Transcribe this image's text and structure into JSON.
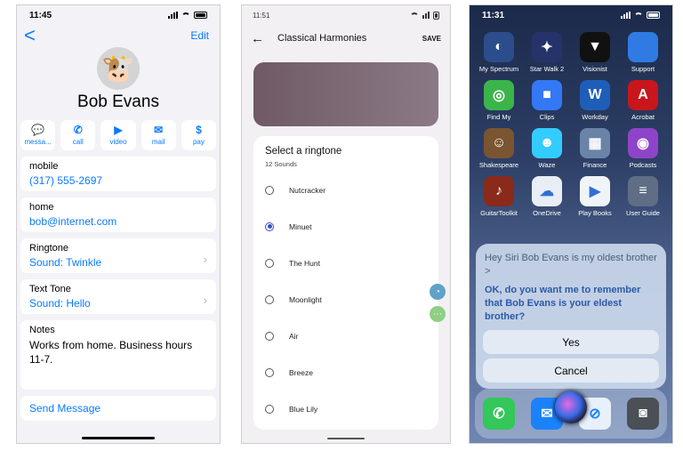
{
  "p1": {
    "status": {
      "time": "11:45"
    },
    "nav": {
      "back": "<",
      "edit": "Edit"
    },
    "contact_name": "Bob Evans",
    "actions": [
      {
        "icon": "message-icon",
        "label": "messa..."
      },
      {
        "icon": "phone-icon",
        "label": "call"
      },
      {
        "icon": "video-icon",
        "label": "video"
      },
      {
        "icon": "mail-icon",
        "label": "mail"
      },
      {
        "icon": "pay-icon",
        "label": "pay"
      }
    ],
    "fields": {
      "mobile_label": "mobile",
      "mobile_value": "(317) 555-2697",
      "home_label": "home",
      "home_value": "bob@internet.com",
      "ringtone_label": "Ringtone",
      "ringtone_value": "Sound: Twinkle",
      "texttone_label": "Text Tone",
      "texttone_value": "Sound: Hello",
      "notes_label": "Notes",
      "notes_value": "Works from home. Business hours 11-7."
    },
    "send_message": "Send Message"
  },
  "p2": {
    "status": {
      "time": "11:51"
    },
    "header": {
      "title": "Classical Harmonies",
      "save": "SAVE"
    },
    "sheet": {
      "title": "Select a ringtone",
      "subtitle": "12 Sounds"
    },
    "ringtones": [
      {
        "name": "Nutcracker",
        "selected": false
      },
      {
        "name": "Minuet",
        "selected": true
      },
      {
        "name": "The Hunt",
        "selected": false
      },
      {
        "name": "Moonlight",
        "selected": false
      },
      {
        "name": "Air",
        "selected": false
      },
      {
        "name": "Breeze",
        "selected": false
      },
      {
        "name": "Blue Lily",
        "selected": false
      }
    ]
  },
  "p3": {
    "status": {
      "time": "11:31"
    },
    "apps": [
      {
        "label": "My Spectrum",
        "icon": "spectrum-icon",
        "color": "#2c4d8c"
      },
      {
        "label": "Star Walk 2",
        "icon": "star-walk-icon",
        "color": "#26336a"
      },
      {
        "label": "Visionist",
        "icon": "visionist-icon",
        "color": "#111111"
      },
      {
        "label": "Support",
        "icon": "apple-support-icon",
        "color": "#2f7be3"
      },
      {
        "label": "Find My",
        "icon": "find-my-icon",
        "color": "#3bb54a"
      },
      {
        "label": "Clips",
        "icon": "clips-icon",
        "color": "#3478f6"
      },
      {
        "label": "Workday",
        "icon": "workday-icon",
        "color": "#1f5eb8"
      },
      {
        "label": "Acrobat",
        "icon": "acrobat-icon",
        "color": "#c8161d"
      },
      {
        "label": "Shakespeare",
        "icon": "shakespeare-icon",
        "color": "#7a5532"
      },
      {
        "label": "Waze",
        "icon": "waze-icon",
        "color": "#33ccff"
      },
      {
        "label": "Finance",
        "icon": "finance-folder-icon",
        "color": "#6a84a8"
      },
      {
        "label": "Podcasts",
        "icon": "podcasts-icon",
        "color": "#8e44c9"
      },
      {
        "label": "GuitarToolkit",
        "icon": "guitar-toolkit-icon",
        "color": "#8a2a1a"
      },
      {
        "label": "OneDrive",
        "icon": "onedrive-icon",
        "color": "#e9eef6"
      },
      {
        "label": "Play Books",
        "icon": "play-books-icon",
        "color": "#f0f4f8"
      },
      {
        "label": "User Guide",
        "icon": "user-guide-icon",
        "color": "#5f6e85"
      }
    ],
    "siri": {
      "utterance": "Hey Siri Bob Evans is my oldest brother >",
      "response": "OK, do you want me to remember that Bob Evans is your eldest brother?",
      "yes": "Yes",
      "cancel": "Cancel"
    },
    "dock": [
      {
        "icon": "phone-app-icon",
        "color": "#34c759"
      },
      {
        "icon": "mail-app-icon",
        "color": "#1a82fb"
      },
      {
        "icon": "safari-icon",
        "color": "#e8f0fb"
      },
      {
        "icon": "camera-icon",
        "color": "#4b4f56"
      }
    ]
  }
}
